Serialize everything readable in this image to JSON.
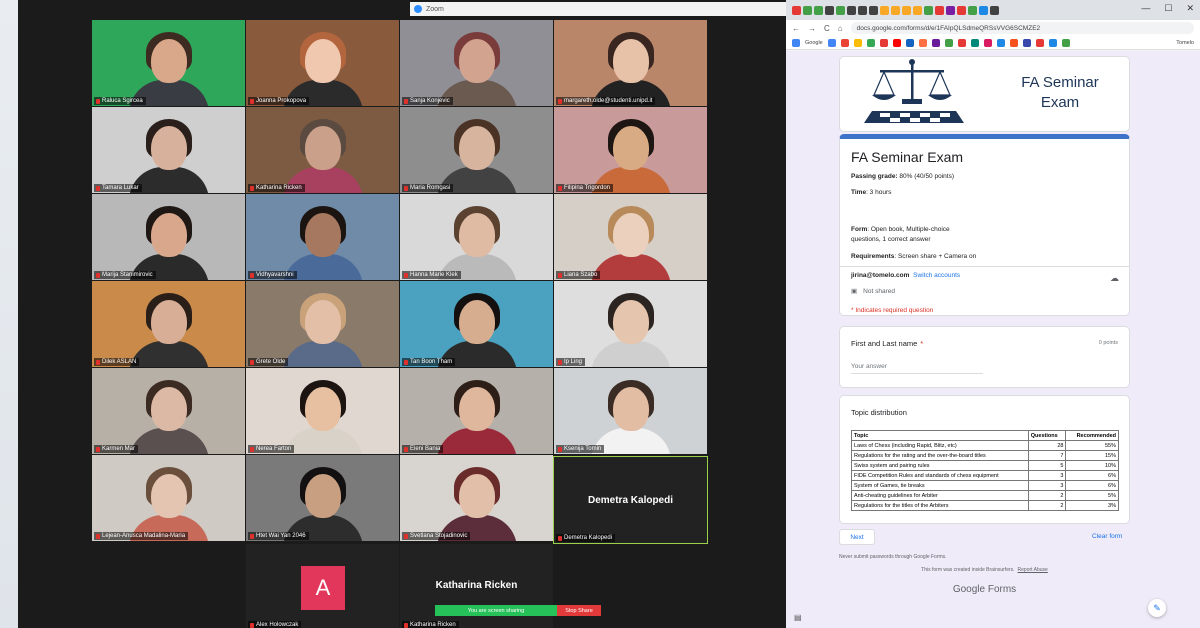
{
  "zoom": {
    "title": "Zoom",
    "participants": [
      {
        "name": "Raluca Sgircea",
        "bg": "#2fa75a",
        "skin": "#d9a88a",
        "shirt": "#3a3c44",
        "hair": "#3d2a20"
      },
      {
        "name": "Joanna Prokopova",
        "bg": "#8a5a3d",
        "skin": "#f0c8b0",
        "shirt": "#2b2b2b",
        "hair": "#b3653e"
      },
      {
        "name": "Sanja Konjevic",
        "bg": "#8f8f95",
        "skin": "#d2a48f",
        "shirt": "#6a5a50",
        "hair": "#7a3b3b"
      },
      {
        "name": "margareth.olde@studenti.unipd.it",
        "bg": "#b9866a",
        "skin": "#e7c1a8",
        "shirt": "#222",
        "hair": "#3a2620"
      },
      {
        "name": "Tamara Lukar",
        "bg": "#cfcfcf",
        "skin": "#d8b19c",
        "shirt": "#2c2c2c",
        "hair": "#2a1f1a"
      },
      {
        "name": "Katharina Ricken",
        "bg": "#7d5a42",
        "skin": "#caa08a",
        "shirt": "#a84060",
        "hair": "#5a4a40"
      },
      {
        "name": "Maria Romgasi",
        "bg": "#8e8e8e",
        "skin": "#d7b49d",
        "shirt": "#424242",
        "hair": "#4a3325"
      },
      {
        "name": "Filipina Trigordon",
        "bg": "#c99a9a",
        "skin": "#d9ab84",
        "shirt": "#c96a3a",
        "hair": "#1e1612"
      },
      {
        "name": "Marija Stanimirovic",
        "bg": "#b8b8b8",
        "skin": "#d9a78c",
        "shirt": "#2a2a2a",
        "hair": "#1f1713"
      },
      {
        "name": "Vidhyavarshni",
        "bg": "#6f8ba8",
        "skin": "#a67860",
        "shirt": "#4a6a9a",
        "hair": "#1b1410"
      },
      {
        "name": "Hanna Marie Klek",
        "bg": "#d9d9d9",
        "skin": "#e0bba4",
        "shirt": "#bababa",
        "hair": "#5b4130"
      },
      {
        "name": "Liana Szabo",
        "bg": "#d5cfc7",
        "skin": "#ead0bd",
        "shirt": "#b33c3c",
        "hair": "#b88a5a"
      },
      {
        "name": "Dilek ASLAN",
        "bg": "#c98a4a",
        "skin": "#d8ae96",
        "shirt": "#303030",
        "hair": "#2a1e18"
      },
      {
        "name": "Grete Olde",
        "bg": "#8a7a6a",
        "skin": "#e2bfa6",
        "shirt": "#5a6b8a",
        "hair": "#c9a27a"
      },
      {
        "name": "Tan Boon Tham",
        "bg": "#4aa2c0",
        "skin": "#d6ad8e",
        "shirt": "#2b2b2b",
        "hair": "#141010"
      },
      {
        "name": "Ip Ling",
        "bg": "#dedede",
        "skin": "#e6c5ae",
        "shirt": "#cfcfcf",
        "hair": "#2c2420"
      },
      {
        "name": "Karmen Mar",
        "bg": "#b7b0a7",
        "skin": "#dbb9a4",
        "shirt": "#5a5050",
        "hair": "#3b2b22"
      },
      {
        "name": "Nerea Farton",
        "bg": "#e0d8d0",
        "skin": "#e6c0a1",
        "shirt": "#d8d2c8",
        "hair": "#1b1411"
      },
      {
        "name": "Eleni Bania",
        "bg": "#b5b0aa",
        "skin": "#dfb79d",
        "shirt": "#9a2a3a",
        "hair": "#2d1f17"
      },
      {
        "name": "Ksenija Tomin",
        "bg": "#cfd2d4",
        "skin": "#e2bca3",
        "shirt": "#f2f2f2",
        "hair": "#3a2c24"
      },
      {
        "name": "Lejean-Anusca Madalina-Maria",
        "bg": "#cfcac3",
        "skin": "#e4c5b2",
        "shirt": "#c86a5a",
        "hair": "#6a4f3d"
      },
      {
        "name": "Htet Wai Yan 2046",
        "bg": "#7a7a7a",
        "skin": "#c99f82",
        "shirt": "#2d2d2d",
        "hair": "#121010"
      },
      {
        "name": "Svetlana Stojadinovic",
        "bg": "#d8d4cf",
        "skin": "#e2bfa8",
        "shirt": "#5c2d3a",
        "hair": "#6a2b2b"
      }
    ],
    "dark_tiles": {
      "demetra_big": "Demetra Kalopedi",
      "demetra_small": "Demetra Kalopedi",
      "alex_initial": "A",
      "alex_name": "Alex Holowczak",
      "katharina_big": "Katharina Ricken",
      "katharina_small": "Katharina Ricken"
    },
    "share_bar": {
      "status": "You are screen sharing",
      "stop": "Stop Share"
    },
    "colors": {
      "accent_green": "#27c15a",
      "stop_red": "#e23a3a",
      "avatar_pink": "#e2375a"
    }
  },
  "chrome": {
    "url": "docs.google.com/forms/d/e/1FAIpQLSdmeQRSsVVG6SCMZE2",
    "win_min": "—",
    "win_max": "☐",
    "win_close": "✕",
    "nav_back": "←",
    "nav_forward": "→",
    "nav_reload": "C",
    "nav_home": "⌂",
    "bookmarks": [
      "Google"
    ],
    "bookmark_tail": "Tomelo",
    "tab_colors": [
      "#e53935",
      "#43a047",
      "#43a047",
      "#424242",
      "#43a047",
      "#424242",
      "#424242",
      "#424242",
      "#f9a825",
      "#f9a825",
      "#f9a825",
      "#f9a825",
      "#43a047",
      "#e53935",
      "#7b1fa2",
      "#e53935",
      "#43a047",
      "#1e88e5",
      "#424242"
    ]
  },
  "form": {
    "header_title": "FA Seminar Exam",
    "title": "FA Seminar Exam",
    "passing_label": "Passing grade:",
    "passing_value": "80% (40/50 points)",
    "time_label": "Time",
    "time_value": ": 3 hours",
    "form_label": "Form",
    "form_value": ": Open book, Multiple-choice",
    "form_value2": "questions, 1 correct answer",
    "req_label": "Requirements",
    "req_value": ": Screen share + Camera on",
    "account_email": "jirina@tomelo.com",
    "switch_account": "Switch accounts",
    "not_shared": "Not shared",
    "required_note": "* Indicates required question",
    "question_label": "First and Last name",
    "question_star": "*",
    "question_points": "0 points",
    "answer_placeholder": "Your answer",
    "topic_title": "Topic distribution",
    "table_headers": [
      "Topic",
      "Questions",
      "Recommended"
    ],
    "table_rows": [
      [
        "Laws of Chess (including Rapid, Blitz, etc)",
        "28",
        "55%"
      ],
      [
        "Regulations for the rating and the over-the-board titles",
        "7",
        "15%"
      ],
      [
        "Swiss system and pairing rules",
        "5",
        "10%"
      ],
      [
        "FIDE Competition Rules and standards of chess equipment",
        "3",
        "6%"
      ],
      [
        "System of Games, tie breaks",
        "3",
        "6%"
      ],
      [
        "Anti-cheating guidelines for Arbiter",
        "2",
        "5%"
      ],
      [
        "Regulations for the titles of the Arbiters",
        "2",
        "3%"
      ]
    ],
    "next_label": "Next",
    "clear_label": "Clear form",
    "never_submit": "Never submit passwords through Google Forms.",
    "created_text": "This form was created inside Brainsurfers.",
    "report_abuse": "Report Abuse",
    "footer_brand": "Google Forms",
    "colors": {
      "accent_blue": "#3c72c8",
      "link_blue": "#1a73e8",
      "required_red": "#d93025",
      "page_bg": "#f0ebf8"
    }
  }
}
